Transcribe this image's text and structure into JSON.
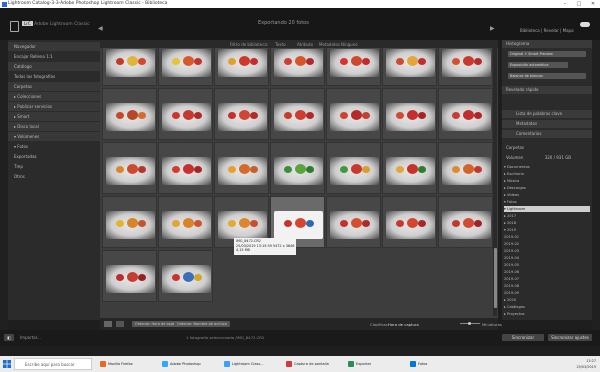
{
  "titlebar": {
    "title": "Lightroom Catalog-3-3-Adobe Photoshop Lightroom Classic - Biblioteca",
    "min": "–",
    "max": "□",
    "close": "✕"
  },
  "header": {
    "identity_badge": "LrC",
    "identity_text": "Adobe Lightroom Classic",
    "center_title": "Exportando 20 fotos",
    "modules": "Biblioteca | Revelar | Mapa"
  },
  "filterbar": {
    "items": [
      "Filtro de biblioteca:",
      "Texto",
      "Atributo",
      "Metadatos",
      "Ninguno"
    ]
  },
  "left_panel": {
    "rows": [
      {
        "label": "Navegador",
        "section": true
      },
      {
        "label": "Encajar    Relleno   1:1",
        "section": false
      },
      {
        "label": "Catálogo",
        "section": true
      },
      {
        "label": "Todas las fotografías",
        "section": false
      },
      {
        "label": "Carpetas",
        "section": true
      },
      {
        "label": "▸ Colecciones",
        "section": true
      },
      {
        "label": "▸ Publicar servicios",
        "section": true
      },
      {
        "label": "▸ Smart",
        "section": true
      },
      {
        "label": "▸ Disco local",
        "section": true
      },
      {
        "label": "▾ Volúmenes",
        "section": true
      },
      {
        "label": "  ▾ Fotos",
        "section": false
      },
      {
        "label": "     Exportadas",
        "section": false
      },
      {
        "label": "  Tmp",
        "section": false
      },
      {
        "label": "  Otros",
        "section": false
      }
    ]
  },
  "grid": {
    "cells": [
      {
        "palette": [
          "#c23a2a",
          "#e0b43a",
          "#d6452f"
        ],
        "selected": false
      },
      {
        "palette": [
          "#e5c52f",
          "#d85a2a",
          "#c4342a"
        ],
        "selected": false
      },
      {
        "palette": [
          "#e0a02c",
          "#d0392a",
          "#c82b2b"
        ],
        "selected": false
      },
      {
        "palette": [
          "#cf3c33",
          "#d6562a",
          "#b32828"
        ],
        "selected": false
      },
      {
        "palette": [
          "#d6342c",
          "#cf4a2d",
          "#c52a2a"
        ],
        "selected": false
      },
      {
        "palette": [
          "#d04a2e",
          "#e5a53a",
          "#c32d2d"
        ],
        "selected": false
      },
      {
        "palette": [
          "#d45130",
          "#c83a2d",
          "#b72b2b"
        ],
        "selected": false
      },
      {
        "palette": [
          "#c44a24",
          "#b8472a",
          "#d8692e"
        ],
        "selected": false
      },
      {
        "palette": [
          "#d0322e",
          "#c33a2e",
          "#b02828"
        ],
        "selected": false
      },
      {
        "palette": [
          "#c82e2e",
          "#d24433",
          "#b32a2a"
        ],
        "selected": false
      },
      {
        "palette": [
          "#c93a2a",
          "#cf3c33",
          "#b42828"
        ],
        "selected": false
      },
      {
        "palette": [
          "#d0422e",
          "#b82a2a",
          "#c34030"
        ],
        "selected": false
      },
      {
        "palette": [
          "#d34a2e",
          "#c32f2f",
          "#a82424"
        ],
        "selected": false
      },
      {
        "palette": [
          "#c93a30",
          "#c22d2d",
          "#b22424"
        ],
        "selected": false
      },
      {
        "palette": [
          "#d8872e",
          "#cf4a2d",
          "#b0392a"
        ],
        "selected": false
      },
      {
        "palette": [
          "#d23c30",
          "#c53030",
          "#a82525"
        ],
        "selected": false
      },
      {
        "palette": [
          "#e6a02f",
          "#d66a2a",
          "#c2612b"
        ],
        "selected": false
      },
      {
        "palette": [
          "#3f8c3a",
          "#5aa43f",
          "#2e7a30"
        ],
        "selected": false
      },
      {
        "palette": [
          "#3e9a3e",
          "#c83a2e",
          "#d6a02f"
        ],
        "selected": false
      },
      {
        "palette": [
          "#e5a53a",
          "#c4342a",
          "#2d7d2d"
        ],
        "selected": false
      },
      {
        "palette": [
          "#e08a2e",
          "#d4632b",
          "#c0392b"
        ],
        "selected": false
      },
      {
        "palette": [
          "#e3b32e",
          "#d7832c",
          "#c4542a"
        ],
        "selected": false
      },
      {
        "palette": [
          "#e1a530",
          "#d8842d",
          "#cb562b"
        ],
        "selected": false
      },
      {
        "palette": [
          "#e3a932",
          "#dd862f",
          "#c94f2c"
        ],
        "selected": false
      },
      {
        "palette": [
          "#c6322c",
          "#d6462f",
          "#2e6ab0"
        ],
        "selected": true
      },
      {
        "palette": [
          "#c3302e",
          "#d54f2f",
          "#b02a2a"
        ],
        "selected": false
      },
      {
        "palette": [
          "#c53a2e",
          "#d3462f",
          "#a82727"
        ],
        "selected": false
      },
      {
        "palette": [
          "#c0392b",
          "#d24a30",
          "#a02424"
        ],
        "selected": false
      },
      {
        "palette": [
          "#b82e2e",
          "#c53d30",
          "#962222"
        ],
        "selected": false
      },
      {
        "palette": [
          "#c8342e",
          "#3d6fb8",
          "#d2a62c"
        ],
        "selected": false
      }
    ],
    "stars": "· · · · ·"
  },
  "tooltip": {
    "line1": "IMG_8472.CR2",
    "line2": "25/03/2019 13:15:39 5472 x 3648",
    "line3": "4,15 MB"
  },
  "right_panel": {
    "top_label": "Histograma",
    "fields": [
      "Original + Smart Preview",
      "Exposición automática",
      "Balance de blancos"
    ],
    "quick_label": "Revelado rápido",
    "keyword_label": "Lista de palabras clave",
    "metadata_label": "Metadatos",
    "comments_label": "Comentarios",
    "folder_section": "Carpetas",
    "volume_label": "Volumen",
    "volume_value": "320 / 931 GB",
    "folders": [
      {
        "label": "▾ Documentos",
        "hl": false
      },
      {
        "label": "  ▸ Escritorio",
        "hl": false
      },
      {
        "label": "  ▸ Música",
        "hl": false
      },
      {
        "label": "  ▸ Descargas",
        "hl": false
      },
      {
        "label": "  ▸ Vídeos",
        "hl": false
      },
      {
        "label": "  ▾ Fotos",
        "hl": false
      },
      {
        "label": "    ▾ Lightroom",
        "hl": true
      },
      {
        "label": "      ▸ 2017",
        "hl": false
      },
      {
        "label": "      ▸ 2018",
        "hl": false
      },
      {
        "label": "      ▾ 2019",
        "hl": false
      },
      {
        "label": "        2019-01",
        "hl": false
      },
      {
        "label": "        2019-02",
        "hl": false
      },
      {
        "label": "        2019-03",
        "hl": false
      },
      {
        "label": "        2019-04",
        "hl": false
      },
      {
        "label": "        2019-05",
        "hl": false
      },
      {
        "label": "        2019-06",
        "hl": false
      },
      {
        "label": "        2019-07",
        "hl": false
      },
      {
        "label": "        2019-08",
        "hl": false
      },
      {
        "label": "        2019-09",
        "hl": false
      },
      {
        "label": "      ▸ 2020",
        "hl": false
      },
      {
        "label": "    ▸ Catálogos",
        "hl": false
      },
      {
        "label": "  ▸ Proyectos",
        "hl": false
      }
    ]
  },
  "toolbar": {
    "btn1": "Ordenar: Hora de captura",
    "btn2": "Ordenar: Nombre de archivo",
    "sort_label": "Clasificar:",
    "sort_value": "Hora de captura",
    "thumbs": "Miniaturas"
  },
  "bottom": {
    "import": "Importar...",
    "export": "Exportar...",
    "sync": "Sincronizar",
    "sync_settings": "Sincronizar ajustes",
    "filename": "1 fotografía seleccionada /IMG_8472.CR2"
  },
  "taskbar": {
    "search": "Escribe aquí para buscar",
    "apps": [
      "Mozilla Firefox",
      "Adobe Photoshop",
      "Lightroom Class...",
      "Captura de pantalla",
      "Exportar",
      "Fotos"
    ],
    "time": "13:27",
    "date": "25/03/2019"
  }
}
